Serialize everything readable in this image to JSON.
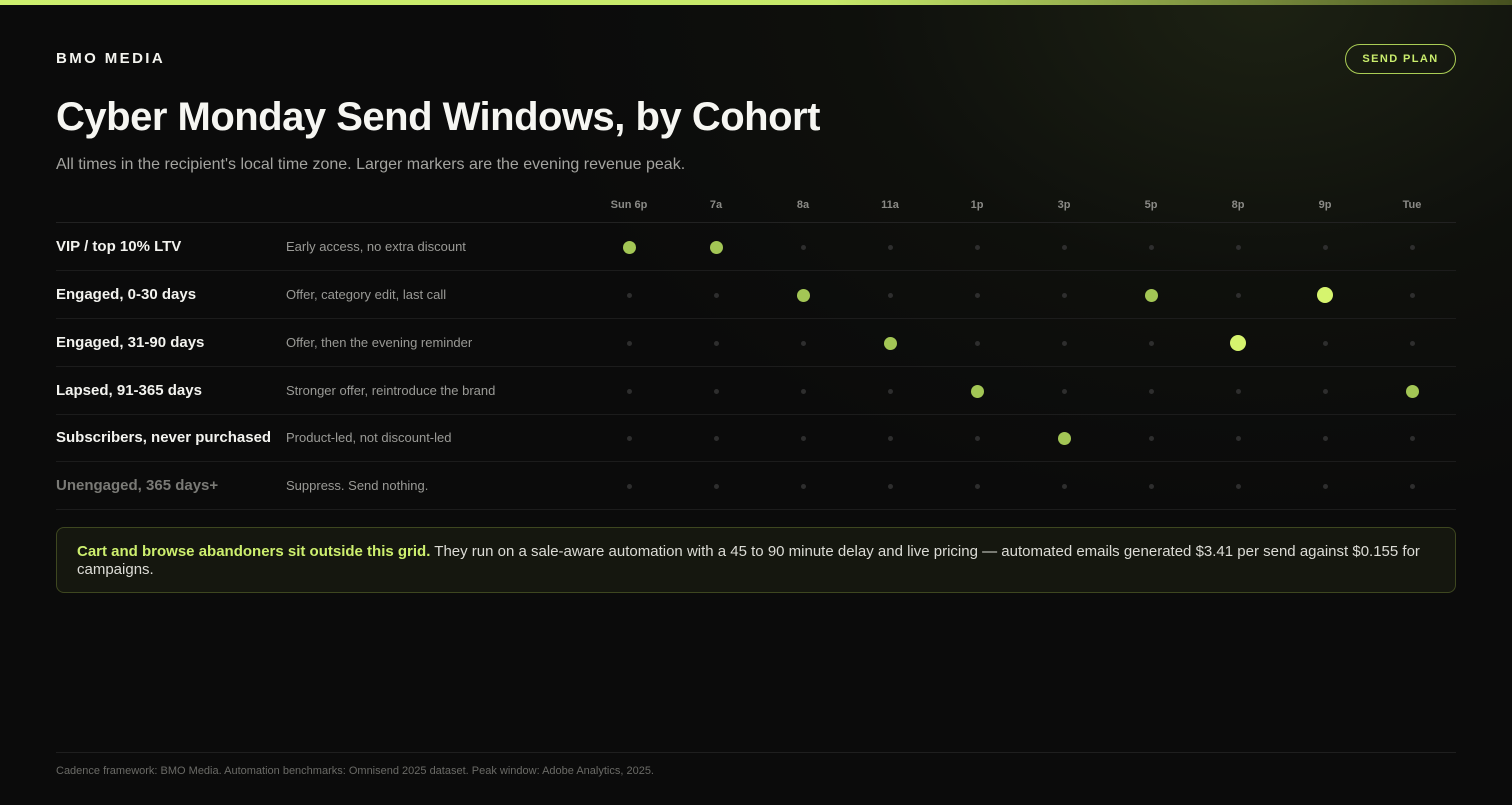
{
  "header": {
    "brand": "BMO MEDIA",
    "plan_button": "SEND PLAN",
    "title": "Cyber Monday Send Windows, by Cohort",
    "subtitle": "All times in the recipient's local time zone. Larger markers are the evening revenue peak."
  },
  "columns": [
    "Sun 6p",
    "7a",
    "8a",
    "11a",
    "1p",
    "3p",
    "5p",
    "8p",
    "9p",
    "Tue"
  ],
  "rows": [
    {
      "cohort": "VIP / top 10% LTV",
      "note": "Early access, no extra discount",
      "muted": false,
      "sends": [
        "on",
        "on",
        "off",
        "off",
        "off",
        "off",
        "off",
        "off",
        "off",
        "off"
      ]
    },
    {
      "cohort": "Engaged, 0-30 days",
      "note": "Offer, category edit, last call",
      "muted": false,
      "sends": [
        "off",
        "off",
        "on",
        "off",
        "off",
        "off",
        "on",
        "off",
        "peak",
        "off"
      ]
    },
    {
      "cohort": "Engaged, 31-90 days",
      "note": "Offer, then the evening reminder",
      "muted": false,
      "sends": [
        "off",
        "off",
        "off",
        "on",
        "off",
        "off",
        "off",
        "peak",
        "off",
        "off"
      ]
    },
    {
      "cohort": "Lapsed, 91-365 days",
      "note": "Stronger offer, reintroduce the brand",
      "muted": false,
      "sends": [
        "off",
        "off",
        "off",
        "off",
        "on",
        "off",
        "off",
        "off",
        "off",
        "on"
      ]
    },
    {
      "cohort": "Subscribers, never purchased",
      "note": "Product-led, not discount-led",
      "muted": false,
      "sends": [
        "off",
        "off",
        "off",
        "off",
        "off",
        "on",
        "off",
        "off",
        "off",
        "off"
      ]
    },
    {
      "cohort": "Unengaged, 365 days+",
      "note": "Suppress. Send nothing.",
      "muted": true,
      "sends": [
        "off",
        "off",
        "off",
        "off",
        "off",
        "off",
        "off",
        "off",
        "off",
        "off"
      ]
    }
  ],
  "callout": {
    "highlight": "Cart and browse abandoners sit outside this grid.",
    "text": "They run on a sale-aware automation with a 45 to 90 minute delay and live pricing — automated emails generated $3.41 per send against $0.155 for campaigns."
  },
  "footer": "Cadence framework: BMO Media. Automation benchmarks: Omnisend 2025 dataset. Peak window: Adobe Analytics, 2025.",
  "colors": {
    "accent": "#cdef6e",
    "send_marker": "#a3c655",
    "peak_marker": "#d6f46e",
    "background": "#0b0b0b"
  }
}
